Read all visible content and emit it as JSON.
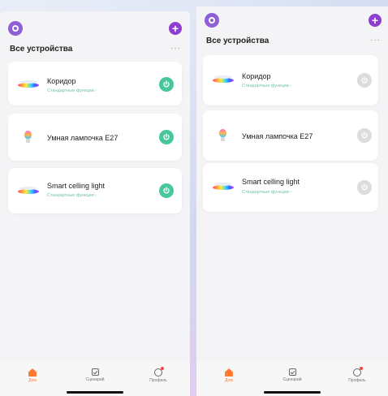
{
  "left": {
    "section_title": "Все устройства",
    "more": "···",
    "devices": [
      {
        "name": "Коридор",
        "sub": "Стандартные функции ›",
        "power": "on"
      },
      {
        "name": "Умная лампочка E27",
        "sub": "",
        "power": "on"
      },
      {
        "name": "Smart celling light",
        "sub": "Стандартные функции ›",
        "power": "on"
      }
    ],
    "nav": [
      {
        "label": "Дом"
      },
      {
        "label": "Сценарий"
      },
      {
        "label": "Профиль"
      }
    ]
  },
  "right": {
    "section_title": "Все устройства",
    "more": "···",
    "devices": [
      {
        "name": "Коридор",
        "sub": "Стандартные функции ›",
        "power": "off"
      },
      {
        "name": "Умная лампочка E27",
        "sub": "",
        "power": "off"
      },
      {
        "name": "Smart celling light",
        "sub": "Стандартные функции ›",
        "power": "off"
      }
    ],
    "nav": [
      {
        "label": "Дом"
      },
      {
        "label": "Сценарий"
      },
      {
        "label": "Профиль"
      }
    ]
  },
  "plus_label": "+",
  "colors": {
    "accent": "#8e3fd0",
    "power_on": "#48c79a",
    "power_off": "#dcdcdc",
    "nav_active": "#ff7a2e"
  }
}
